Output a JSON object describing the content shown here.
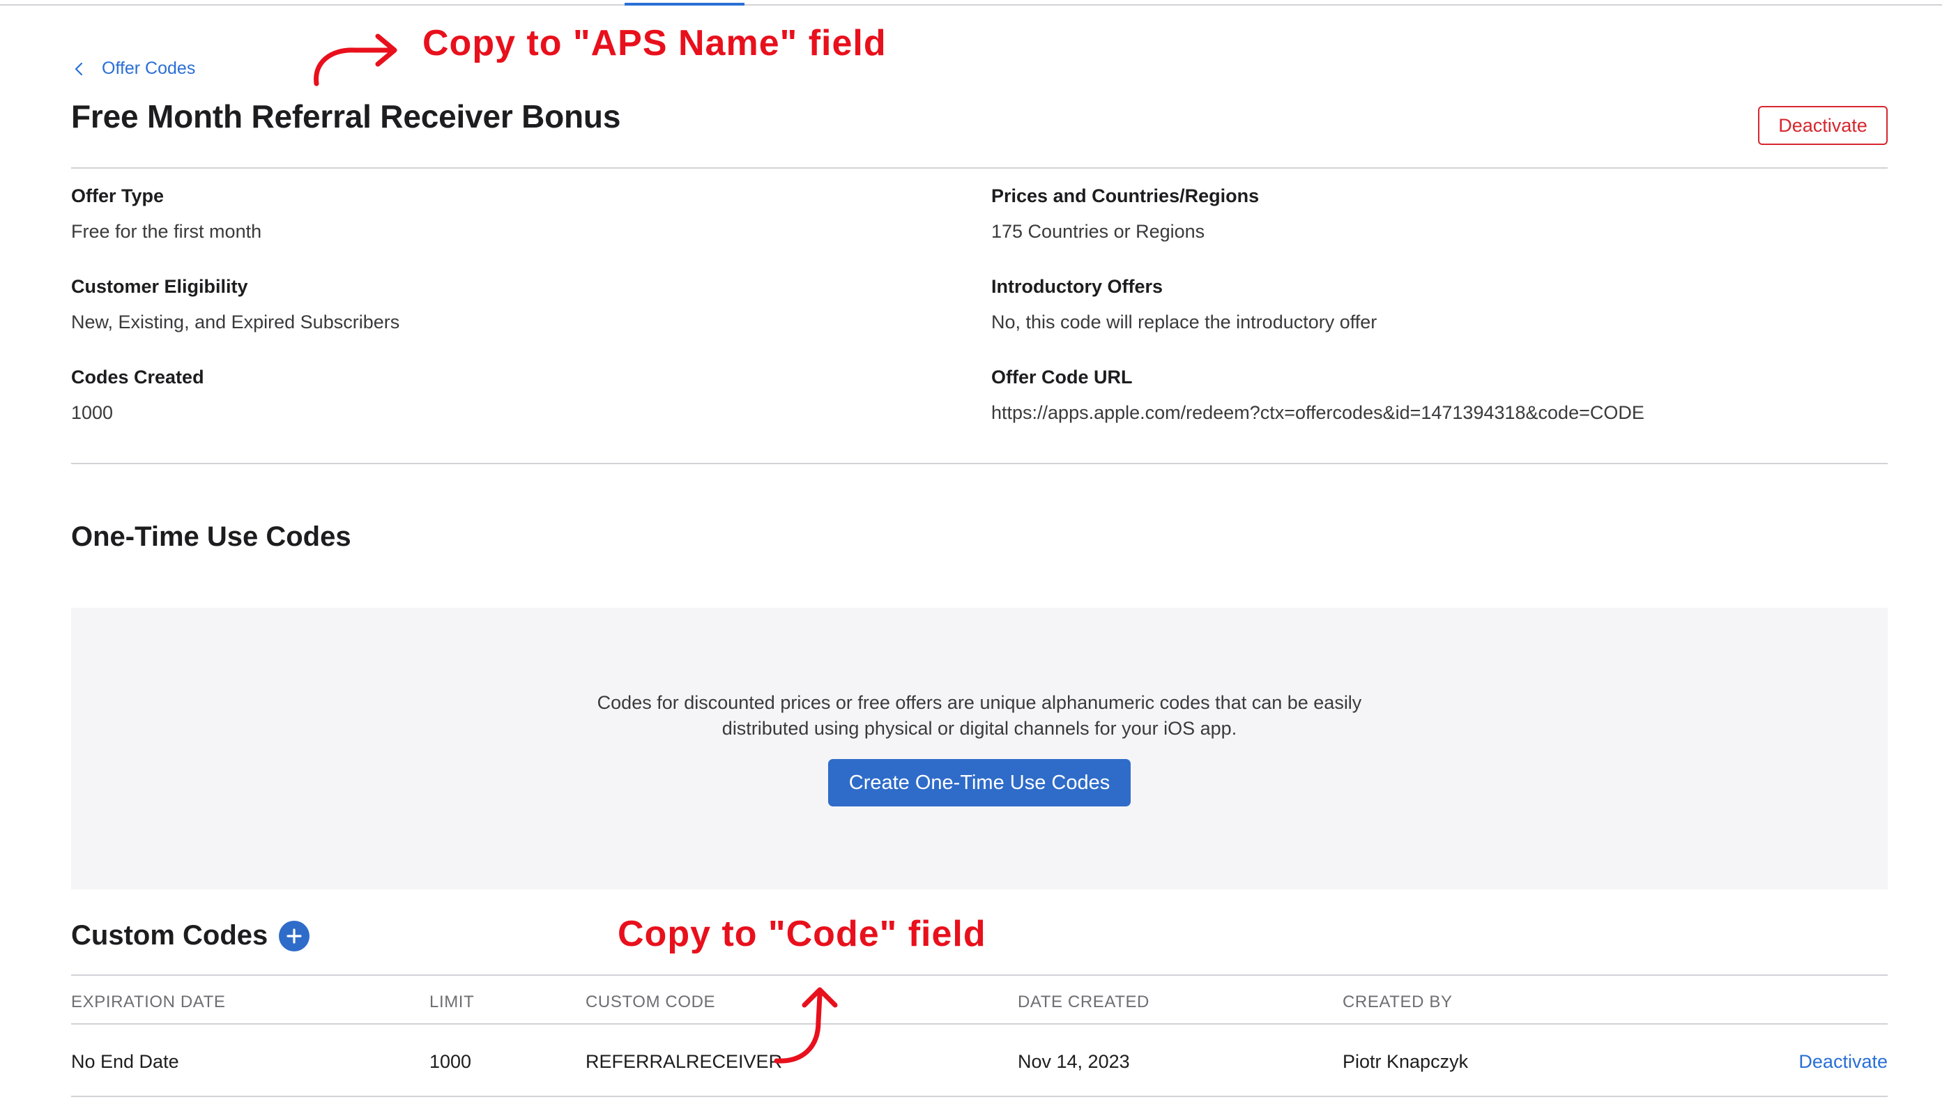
{
  "breadcrumb": {
    "label": "Offer Codes"
  },
  "page": {
    "title": "Free Month Referral Receiver Bonus",
    "deactivate_label": "Deactivate"
  },
  "info": {
    "offer_type": {
      "label": "Offer Type",
      "value": "Free for the first month"
    },
    "customer_eligibility": {
      "label": "Customer Eligibility",
      "value": "New, Existing, and Expired Subscribers"
    },
    "codes_created": {
      "label": "Codes Created",
      "value": "1000"
    },
    "prices_countries": {
      "label": "Prices and Countries/Regions",
      "value": "175 Countries or Regions"
    },
    "introductory_offers": {
      "label": "Introductory Offers",
      "value": "No, this code will replace the introductory offer"
    },
    "offer_code_url": {
      "label": "Offer Code URL",
      "value": "https://apps.apple.com/redeem?ctx=offercodes&id=1471394318&code=CODE"
    }
  },
  "one_time": {
    "title": "One-Time Use Codes",
    "description_line1": "Codes for discounted prices or free offers are unique alphanumeric codes that can be easily",
    "description_line2": "distributed using physical or digital channels for your iOS app.",
    "create_label": "Create One-Time Use Codes"
  },
  "custom_codes": {
    "title": "Custom Codes",
    "add_icon": "plus-circle-icon",
    "columns": [
      "EXPIRATION DATE",
      "LIMIT",
      "CUSTOM CODE",
      "DATE CREATED",
      "CREATED BY"
    ],
    "rows": [
      {
        "expiration_date": "No End Date",
        "limit": "1000",
        "custom_code": "REFERRALRECEIVER",
        "date_created": "Nov 14, 2023",
        "created_by": "Piotr Knapczyk",
        "action": "Deactivate"
      }
    ]
  },
  "annotations": {
    "aps_name": "Copy to \"APS Name\" field",
    "code": "Copy to \"Code\" field",
    "color": "#e8101c"
  },
  "colors": {
    "accent": "#2a6fd6",
    "danger": "#d7262e",
    "panel_bg": "#f5f5f7"
  }
}
